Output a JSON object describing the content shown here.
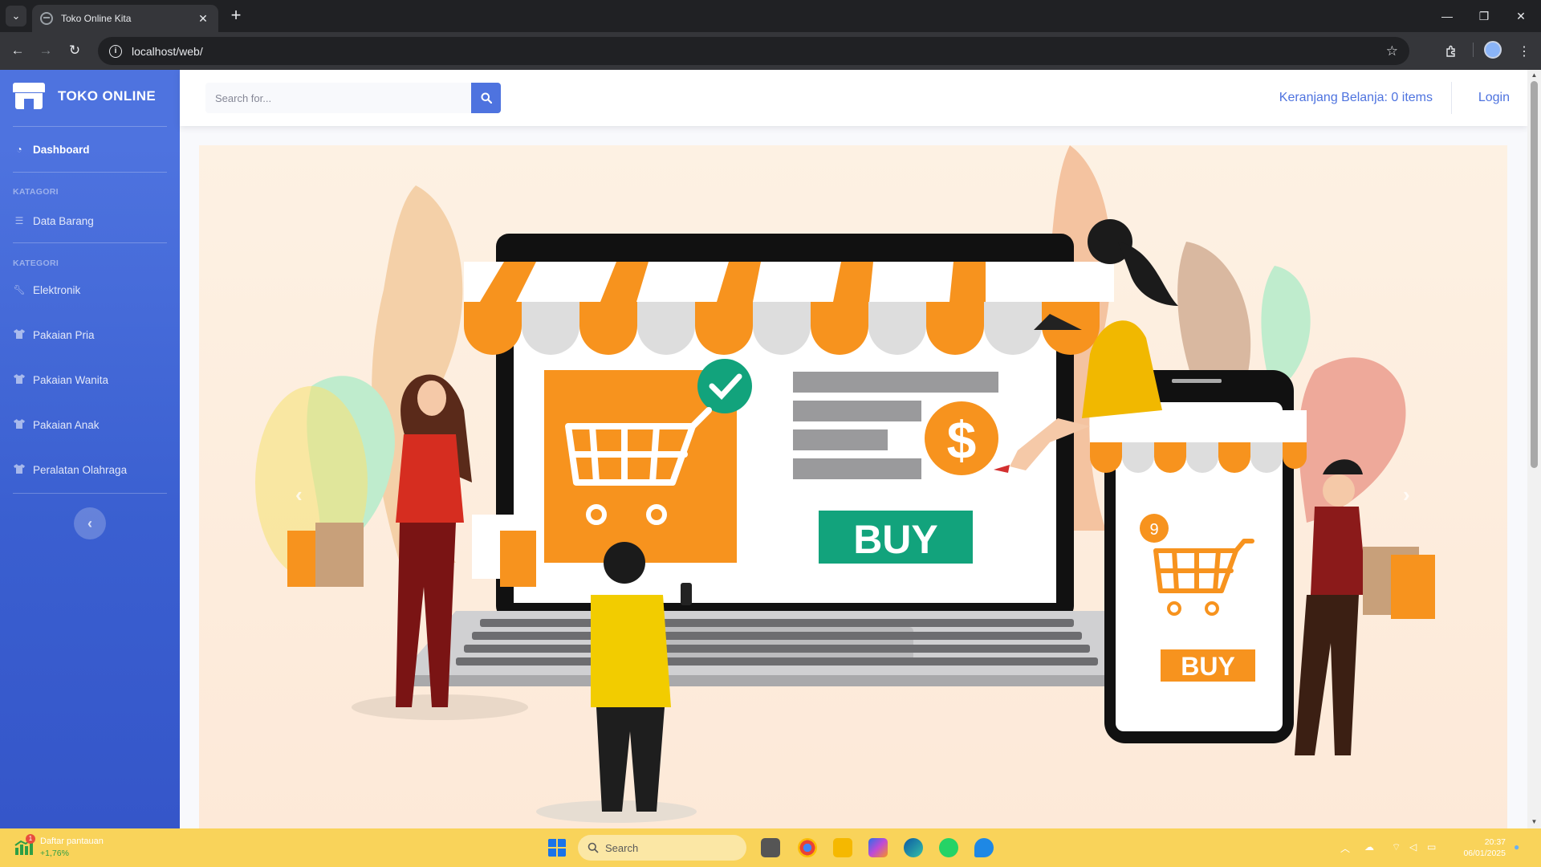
{
  "browser": {
    "tab_title": "Toko Online Kita",
    "url": "localhost/web/"
  },
  "sidebar": {
    "brand": "TOKO ONLINE",
    "dashboard_label": "Dashboard",
    "section1_heading": "KATAGORI",
    "data_barang_label": "Data Barang",
    "section2_heading": "KATEGORI",
    "categories": [
      {
        "label": "Elektronik",
        "icon": "wrench-icon"
      },
      {
        "label": "Pakaian Pria",
        "icon": "tshirt-icon"
      },
      {
        "label": "Pakaian Wanita",
        "icon": "tshirt-icon"
      },
      {
        "label": "Pakaian Anak",
        "icon": "tshirt-icon"
      },
      {
        "label": "Peralatan Olahraga",
        "icon": "tshirt-icon"
      }
    ],
    "toggle_glyph": "‹"
  },
  "topbar": {
    "search_placeholder": "Search for...",
    "cart_label": "Keranjang Belanja: 0 items",
    "login_label": "Login"
  },
  "hero": {
    "buy_laptop": "BUY",
    "buy_phone": "BUY",
    "cart_badge": "9",
    "dollar": "$"
  },
  "taskbar": {
    "watchlist_title": "Daftar pantauan",
    "watchlist_value": "+1,76%",
    "watchlist_badge": "1",
    "search_label": "Search",
    "time": "20:37",
    "date": "06/01/2025"
  },
  "colors": {
    "primary": "#4e73df",
    "orange": "#f7931e",
    "green_buy": "#12a37c",
    "taskbar": "#f9d35a"
  }
}
